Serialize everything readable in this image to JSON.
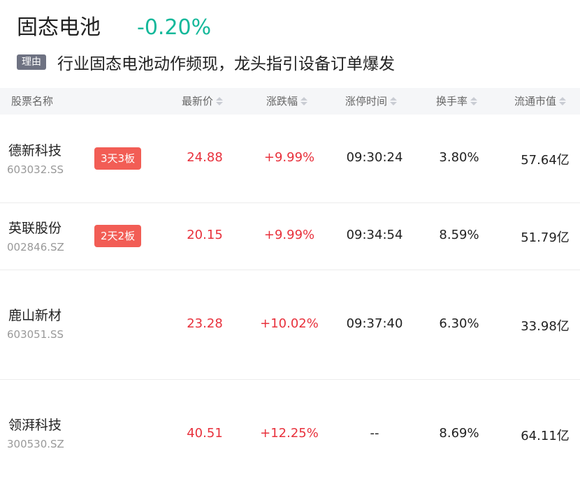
{
  "header": {
    "sector_name": "固态电池",
    "sector_change": "-0.20%",
    "reason_badge": "理由",
    "reason_text": "行业固态电池动作频现，龙头指引设备订单爆发"
  },
  "colors": {
    "up": "#e8313c",
    "down": "#14b89a",
    "badge": "#f25d55",
    "reason_badge": "#6e7282",
    "header_bg": "#f5f6f8"
  },
  "table": {
    "columns": [
      "股票名称",
      "最新价",
      "涨跌幅",
      "涨停时间",
      "换手率",
      "流通市值"
    ],
    "rows": [
      {
        "name": "德新科技",
        "code": "603032.SS",
        "badge": "3天3板",
        "price": "24.88",
        "change": "+9.99%",
        "limit_time": "09:30:24",
        "turnover": "3.80%",
        "float_cap": "57.64亿"
      },
      {
        "name": "英联股份",
        "code": "002846.SZ",
        "badge": "2天2板",
        "price": "20.15",
        "change": "+9.99%",
        "limit_time": "09:34:54",
        "turnover": "8.59%",
        "float_cap": "51.79亿"
      },
      {
        "name": "鹿山新材",
        "code": "603051.SS",
        "badge": "",
        "price": "23.28",
        "change": "+10.02%",
        "limit_time": "09:37:40",
        "turnover": "6.30%",
        "float_cap": "33.98亿"
      },
      {
        "name": "领湃科技",
        "code": "300530.SZ",
        "badge": "",
        "price": "40.51",
        "change": "+12.25%",
        "limit_time": "--",
        "turnover": "8.69%",
        "float_cap": "64.11亿"
      }
    ]
  }
}
